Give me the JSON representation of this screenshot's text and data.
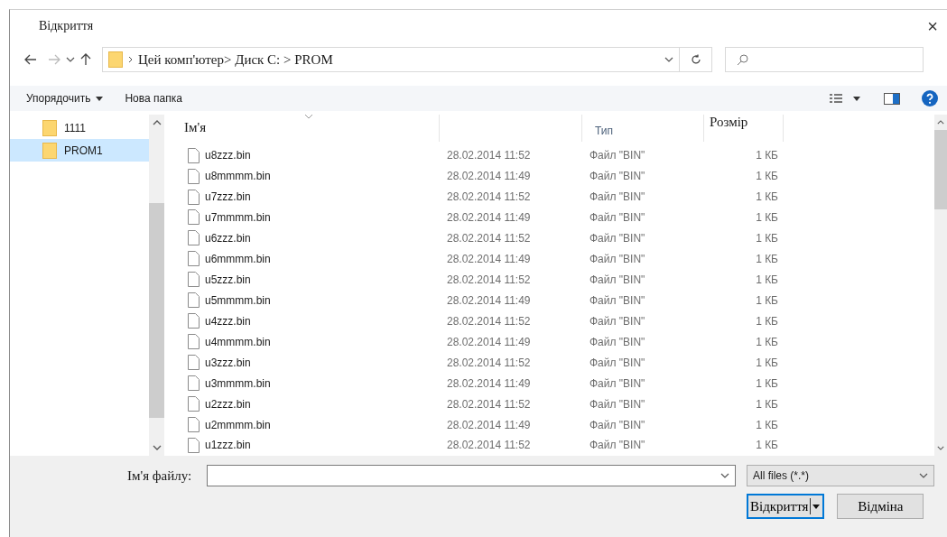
{
  "window": {
    "title": "Відкриття",
    "close": "×"
  },
  "address": {
    "path": "Цей комп'ютер> Диск C: > PROM"
  },
  "toolbar": {
    "organize": "Упорядочить",
    "new_folder": "Нова папка"
  },
  "sidebar": {
    "items": [
      {
        "label": "1111",
        "selected": false
      },
      {
        "label": "PROM1",
        "selected": true
      }
    ]
  },
  "table": {
    "columns": {
      "name": "Ім'я",
      "type": "Тип",
      "size": "Розмір"
    },
    "rows": [
      {
        "name": "u8zzz.bin",
        "date": "28.02.2014 11:52",
        "type": "Файл \"BIN\"",
        "size": "1 КБ"
      },
      {
        "name": "u8mmmm.bin",
        "date": "28.02.2014 11:49",
        "type": "Файл \"BIN\"",
        "size": "1 КБ"
      },
      {
        "name": "u7zzz.bin",
        "date": "28.02.2014 11:52",
        "type": "Файл \"BIN\"",
        "size": "1 КБ"
      },
      {
        "name": "u7mmmm.bin",
        "date": "28.02.2014 11:49",
        "type": "Файл \"BIN\"",
        "size": "1 КБ"
      },
      {
        "name": "u6zzz.bin",
        "date": "28.02.2014 11:52",
        "type": "Файл \"BIN\"",
        "size": "1 КБ"
      },
      {
        "name": "u6mmmm.bin",
        "date": "28.02.2014 11:49",
        "type": "Файл \"BIN\"",
        "size": "1 КБ"
      },
      {
        "name": "u5zzz.bin",
        "date": "28.02.2014 11:52",
        "type": "Файл \"BIN\"",
        "size": "1 КБ"
      },
      {
        "name": "u5mmmm.bin",
        "date": "28.02.2014 11:49",
        "type": "Файл \"BIN\"",
        "size": "1 КБ"
      },
      {
        "name": "u4zzz.bin",
        "date": "28.02.2014 11:52",
        "type": "Файл \"BIN\"",
        "size": "1 КБ"
      },
      {
        "name": "u4mmmm.bin",
        "date": "28.02.2014 11:49",
        "type": "Файл \"BIN\"",
        "size": "1 КБ"
      },
      {
        "name": "u3zzz.bin",
        "date": "28.02.2014 11:52",
        "type": "Файл \"BIN\"",
        "size": "1 КБ"
      },
      {
        "name": "u3mmmm.bin",
        "date": "28.02.2014 11:49",
        "type": "Файл \"BIN\"",
        "size": "1 КБ"
      },
      {
        "name": "u2zzz.bin",
        "date": "28.02.2014 11:52",
        "type": "Файл \"BIN\"",
        "size": "1 КБ"
      },
      {
        "name": "u2mmmm.bin",
        "date": "28.02.2014 11:49",
        "type": "Файл \"BIN\"",
        "size": "1 КБ"
      },
      {
        "name": "u1zzz.bin",
        "date": "28.02.2014 11:52",
        "type": "Файл \"BIN\"",
        "size": "1 КБ"
      }
    ]
  },
  "footer": {
    "filename_label": "Ім'я файлу:",
    "filter": "All files (*.*)",
    "open_button": "Відкриття",
    "cancel_button": "Відміна"
  }
}
